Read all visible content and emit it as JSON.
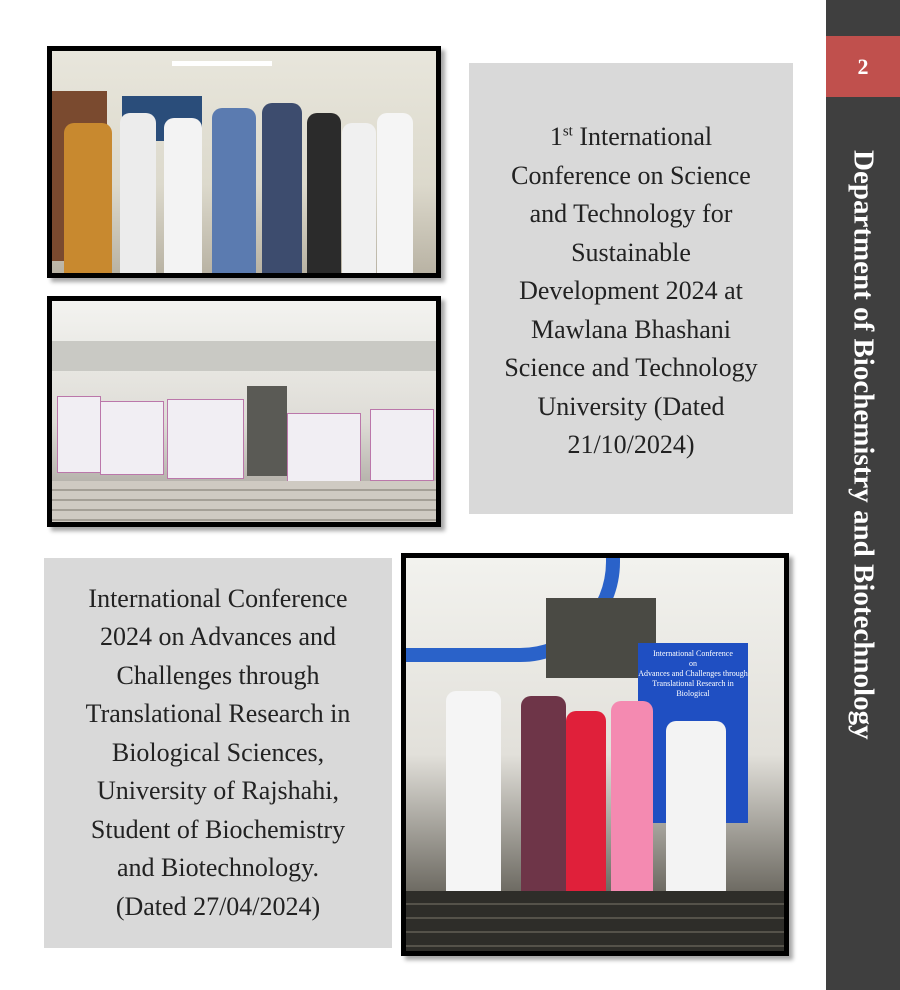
{
  "sidebar": {
    "page_number": "2",
    "department": "Department of Biochemistry and Biotechnology"
  },
  "captions": {
    "conference1": [
      "1st International",
      "Conference on Science",
      "and Technology for",
      "Sustainable",
      "Development 2024 at",
      "Mawlana Bhashani",
      "Science and Technology",
      "University (Dated",
      "21/10/2024)"
    ],
    "conference2": [
      "International Conference",
      "2024 on Advances and",
      "Challenges through",
      "Translational Research in",
      "Biological Sciences,",
      "University of Rajshahi,",
      "Student of Biochemistry",
      "and Biotechnology.",
      "(Dated 27/04/2024)"
    ]
  },
  "photo3_banner": [
    "International Conference",
    "on",
    "Advances and Challenges through",
    "Translational Research in Biological"
  ],
  "colors": {
    "sidebar": "#3f3f3f",
    "page_badge": "#c0504d",
    "caption_bg": "#d9d9d9"
  }
}
